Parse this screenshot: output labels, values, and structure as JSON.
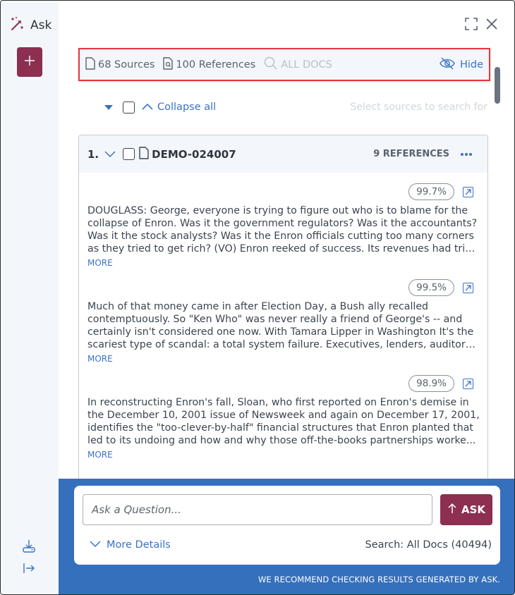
{
  "app": {
    "title": "Ask"
  },
  "rail": {
    "title_icon": "magic-wand-icon",
    "new_button_icon": "plus-icon",
    "bottom_icons": [
      "download-icon",
      "collapse-panel-icon"
    ]
  },
  "window_controls": {
    "expand_icon": "expand-icon",
    "close_icon": "close-icon"
  },
  "header_bar": {
    "sources_label": "68 Sources",
    "references_label": "100 References",
    "search_label": "ALL DOCS",
    "hide_label": "Hide"
  },
  "controls": {
    "collapse_all_label": "Collapse all",
    "select_hint": "Select sources to search for"
  },
  "document": {
    "number": "1.",
    "title": "DEMO-024007",
    "references_count_label": "9 REFERENCES",
    "references": [
      {
        "score": "99.7%",
        "lines": [
          "DOUGLASS: George, everyone is trying to figure out who is to blame for the",
          "collapse of Enron. Was it the government regulators? Was it the accountants?",
          "Was it the stock analysts? Was it the Enron officials cutting too many corners",
          "as they tried to get rich? (VO) Enron reeked of success. Its revenues had triple..."
        ],
        "more_label": "MORE"
      },
      {
        "score": "99.5%",
        "lines": [
          "Much of that money came in after Election Day, a Bush ally recalled",
          "contemptuously. So \"Ken Who\" was never really a friend of George's -- and",
          "certainly isn't considered one now. With Tamara Lipper in Washington It's the",
          "scariest type of scandal: a total system failure. Executives, lenders, auditors..."
        ],
        "more_label": "MORE"
      },
      {
        "score": "98.9%",
        "lines": [
          "In reconstructing Enron's fall, Sloan, who first reported on Enron's demise in",
          "the December 10, 2001 issue of Newsweek and again on December 17, 2001,",
          "identifies the \"too-clever-by-half\" financial structures that Enron planted that",
          "led to its undoing and how and why those off-the-books partnerships worke..."
        ],
        "more_label": "MORE"
      }
    ]
  },
  "ask": {
    "input_placeholder": "Ask a Question...",
    "input_value": "",
    "button_label": "ASK",
    "more_details_label": "More Details",
    "search_scope": "Search: All Docs (40494)",
    "disclaimer": "WE RECOMMEND CHECKING RESULTS GENERATED BY ASK."
  },
  "colors": {
    "accent_blue": "#3a72c4",
    "brand_maroon": "#8c2f50",
    "footer_blue": "#3570bd",
    "highlight_red": "#e8353a"
  }
}
